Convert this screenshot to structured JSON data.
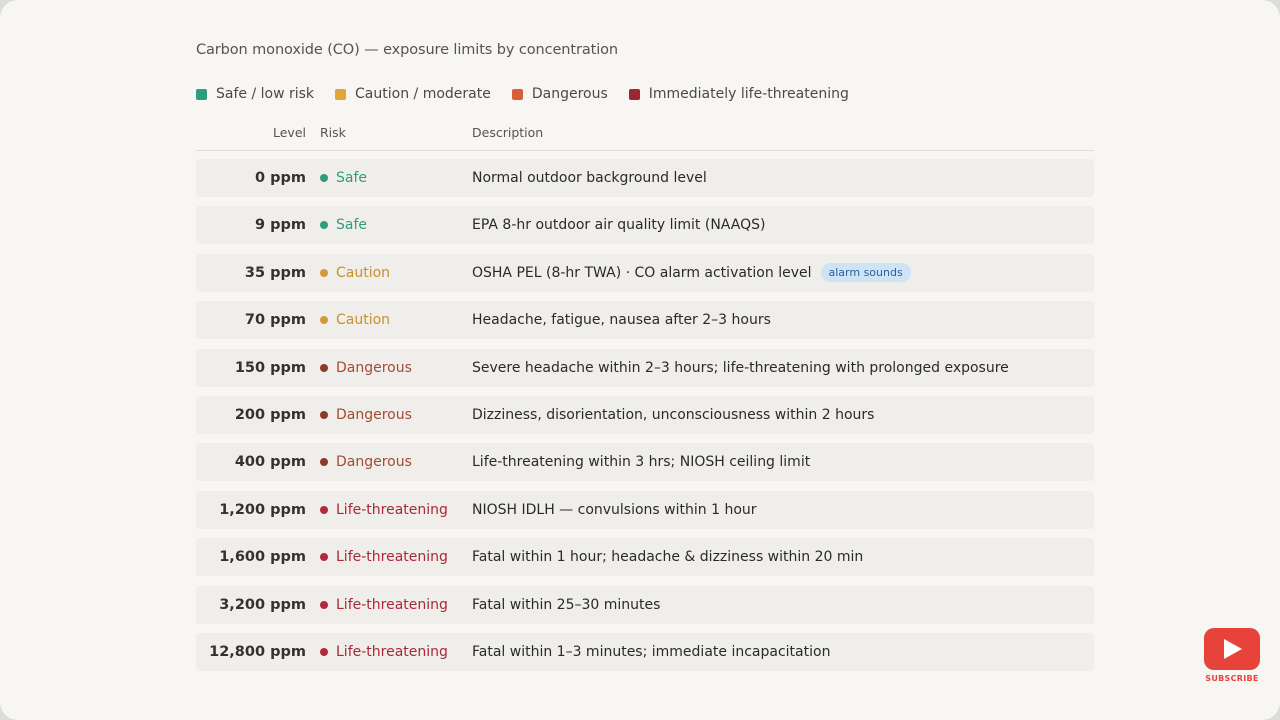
{
  "title": "Carbon monoxide (CO) — exposure limits by concentration",
  "legend": [
    {
      "label": "Safe / low risk",
      "color": "#2f9c80"
    },
    {
      "label": "Caution / moderate",
      "color": "#e0a63a"
    },
    {
      "label": "Dangerous",
      "color": "#d95f3a"
    },
    {
      "label": "Immediately life-threatening",
      "color": "#9a2733"
    }
  ],
  "columns": {
    "level": "Level",
    "risk": "Risk",
    "description": "Description"
  },
  "risk_colors": {
    "safe": {
      "dot": "#2f9c80",
      "text": "#2f9c80"
    },
    "caution": {
      "dot": "#d59a36",
      "text": "#c98f2c"
    },
    "dangerous": {
      "dot": "#8e3a2a",
      "text": "#a54a33"
    },
    "life": {
      "dot": "#b02a3a",
      "text": "#a8283a"
    }
  },
  "rows": [
    {
      "level": "0 ppm",
      "risk": "Safe",
      "risk_key": "safe",
      "description": "Normal outdoor background level",
      "badge": ""
    },
    {
      "level": "9 ppm",
      "risk": "Safe",
      "risk_key": "safe",
      "description": "EPA 8-hr outdoor air quality limit (NAAQS)",
      "badge": ""
    },
    {
      "level": "35 ppm",
      "risk": "Caution",
      "risk_key": "caution",
      "description": "OSHA PEL (8-hr TWA) · CO alarm activation level",
      "badge": "alarm sounds"
    },
    {
      "level": "70 ppm",
      "risk": "Caution",
      "risk_key": "caution",
      "description": "Headache, fatigue, nausea after 2–3 hours",
      "badge": ""
    },
    {
      "level": "150 ppm",
      "risk": "Dangerous",
      "risk_key": "dangerous",
      "description": "Severe headache within 2–3 hours; life-threatening with prolonged exposure",
      "badge": ""
    },
    {
      "level": "200 ppm",
      "risk": "Dangerous",
      "risk_key": "dangerous",
      "description": "Dizziness, disorientation, unconsciousness within 2 hours",
      "badge": ""
    },
    {
      "level": "400 ppm",
      "risk": "Dangerous",
      "risk_key": "dangerous",
      "description": "Life-threatening within 3 hrs; NIOSH ceiling limit",
      "badge": ""
    },
    {
      "level": "1,200 ppm",
      "risk": "Life-threatening",
      "risk_key": "life",
      "description": "NIOSH IDLH — convulsions within 1 hour",
      "badge": ""
    },
    {
      "level": "1,600 ppm",
      "risk": "Life-threatening",
      "risk_key": "life",
      "description": "Fatal within 1 hour; headache & dizziness within 20 min",
      "badge": ""
    },
    {
      "level": "3,200 ppm",
      "risk": "Life-threatening",
      "risk_key": "life",
      "description": "Fatal within 25–30 minutes",
      "badge": ""
    },
    {
      "level": "12,800 ppm",
      "risk": "Life-threatening",
      "risk_key": "life",
      "description": "Fatal within 1–3 minutes; immediate incapacitation",
      "badge": ""
    }
  ],
  "youtube": {
    "label": "SUBSCRIBE",
    "icon": "youtube-play-icon"
  }
}
